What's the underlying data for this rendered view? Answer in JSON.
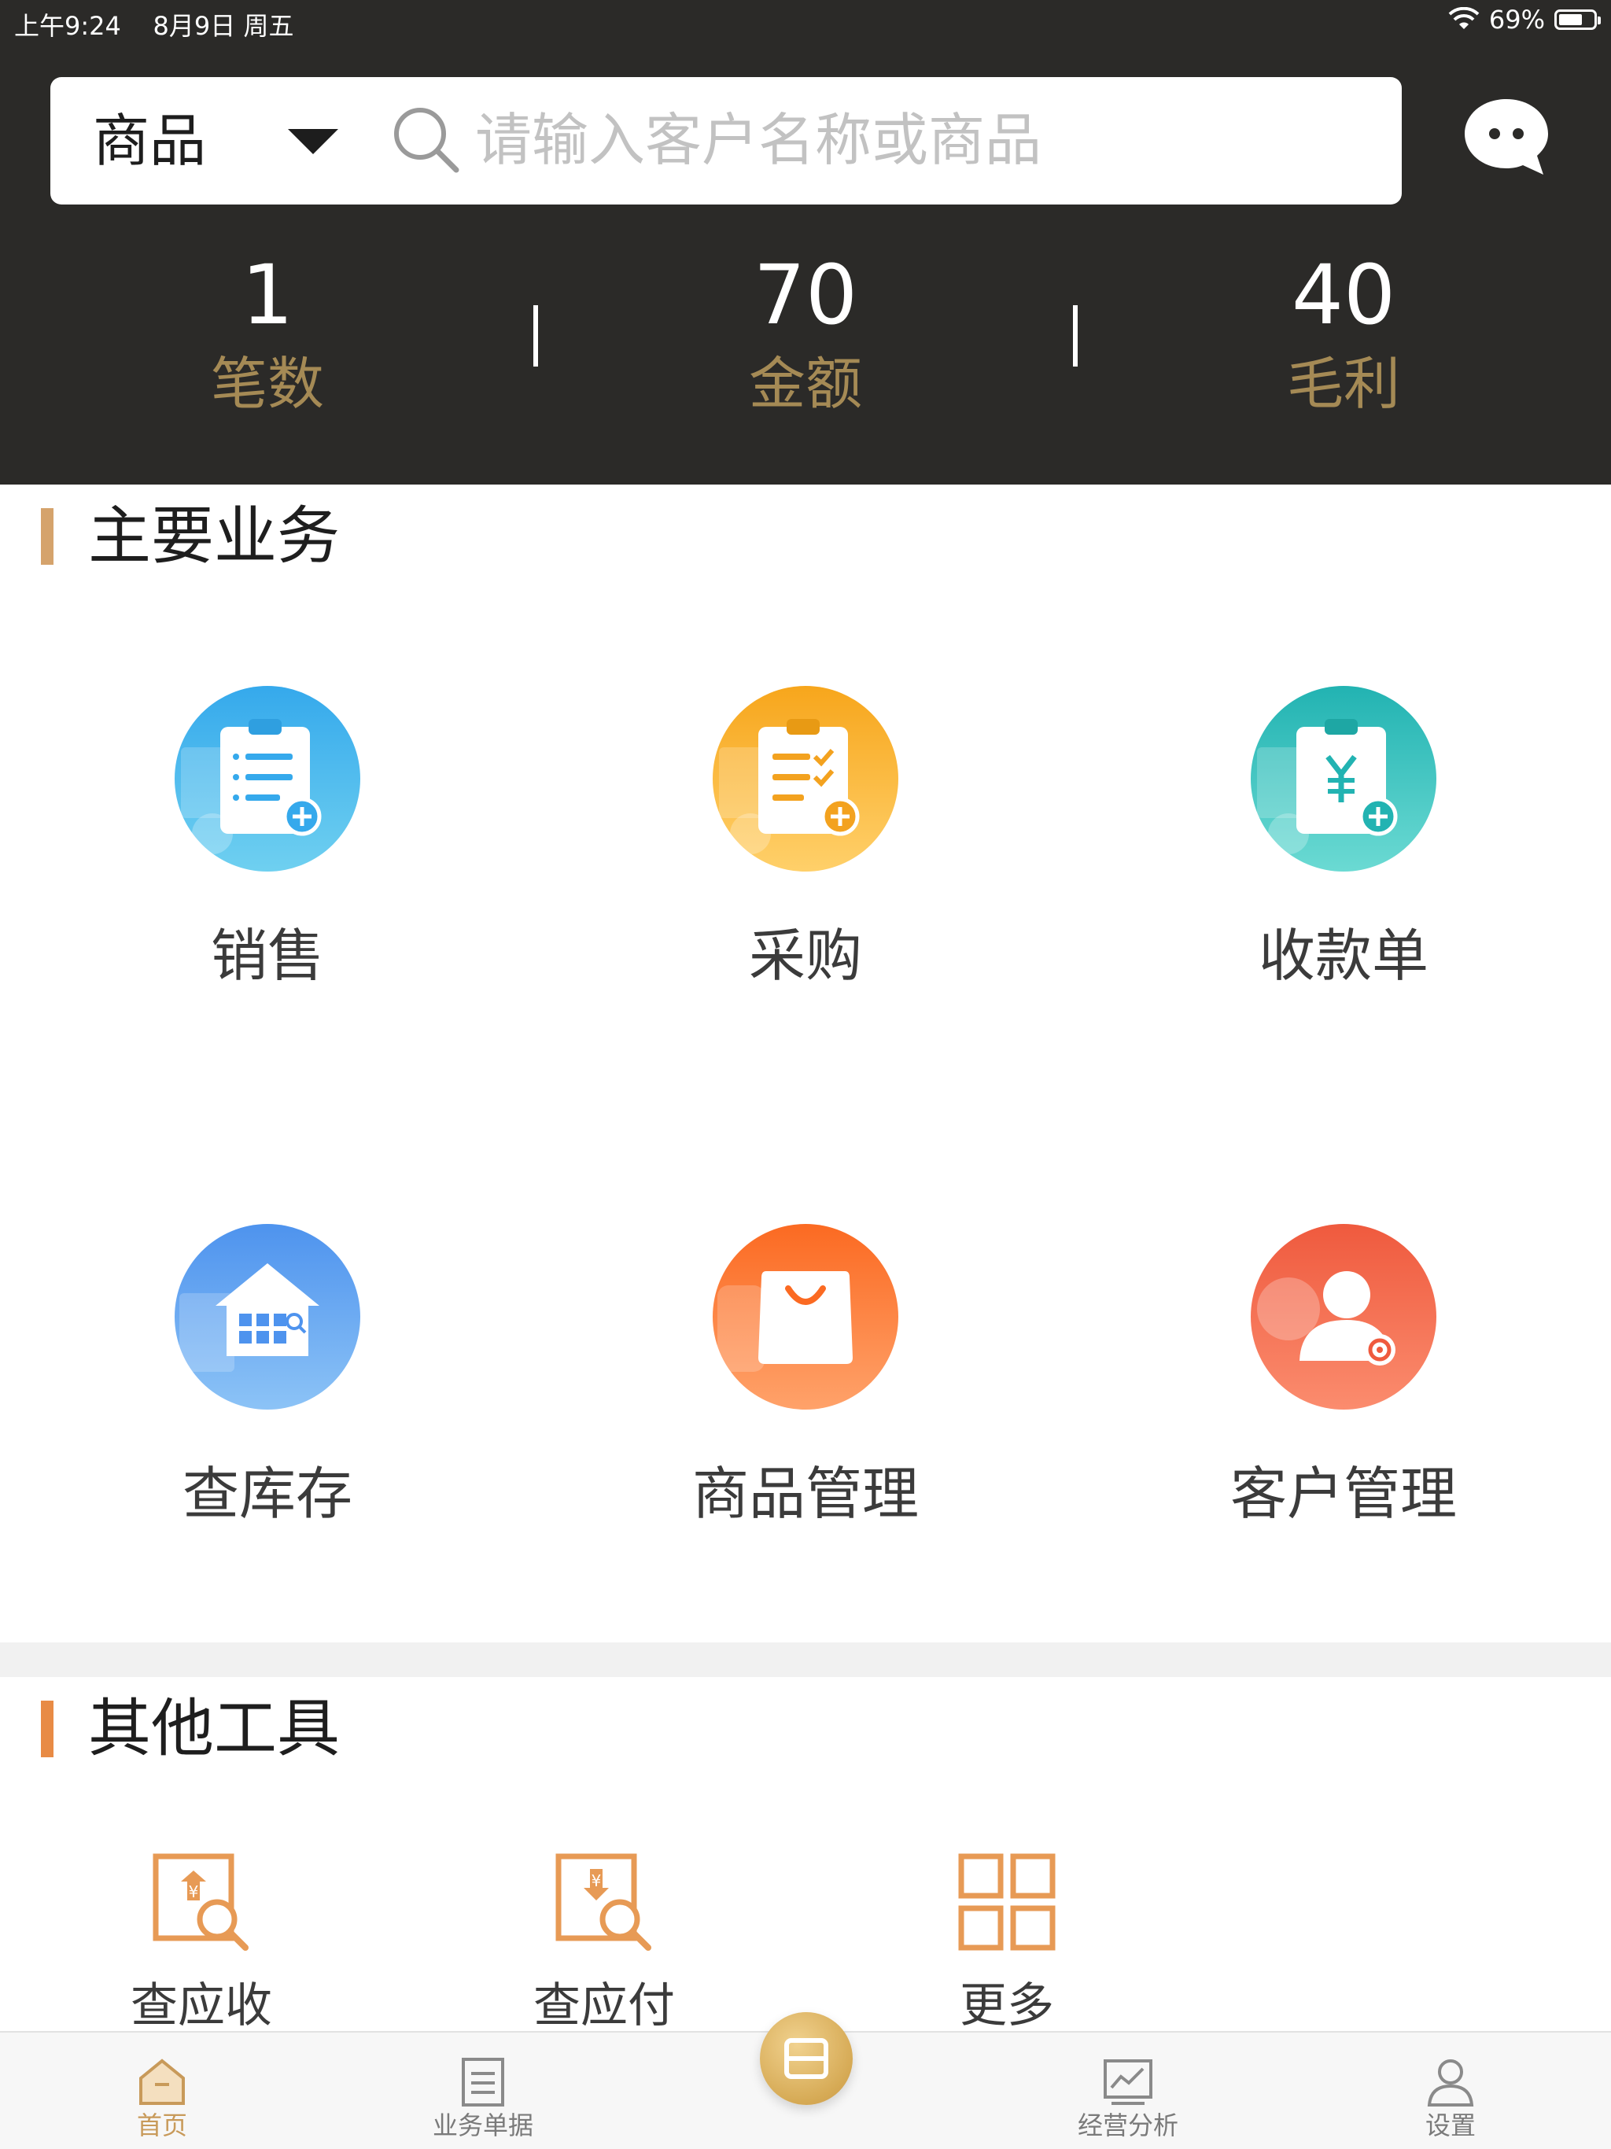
{
  "status_bar": {
    "time_date": "上午9:24    8月9日 周五",
    "battery_percent": "69%",
    "battery_level": 0.69
  },
  "search": {
    "category": "商品",
    "placeholder": "请输入客户名称或商品"
  },
  "stats": [
    {
      "value": "1",
      "label": "笔数"
    },
    {
      "value": "70",
      "label": "金额"
    },
    {
      "value": "40",
      "label": "毛利"
    }
  ],
  "main_business": {
    "title": "主要业务",
    "tiles": [
      {
        "label": "销售",
        "icon": "sales-clipboard-icon",
        "color": "#3fb6ea"
      },
      {
        "label": "采购",
        "icon": "purchase-clipboard-icon",
        "color": "#f8b12d"
      },
      {
        "label": "收款单",
        "icon": "receipt-clipboard-icon",
        "color": "#2fc3bd"
      },
      {
        "label": "查库存",
        "icon": "inventory-house-icon",
        "color": "#5d9ef0"
      },
      {
        "label": "商品管理",
        "icon": "shopping-bag-icon",
        "color": "#fb7a32"
      },
      {
        "label": "客户管理",
        "icon": "customer-person-icon",
        "color": "#f05f45"
      }
    ]
  },
  "other_tools": {
    "title": "其他工具",
    "tools": [
      {
        "label": "查应收",
        "icon": "receivable-search-icon"
      },
      {
        "label": "查应付",
        "icon": "payable-search-icon"
      },
      {
        "label": "更多",
        "icon": "grid-more-icon"
      }
    ]
  },
  "bottom_nav": {
    "items": [
      {
        "label": "首页",
        "icon": "home-icon",
        "active": true
      },
      {
        "label": "业务单据",
        "icon": "document-icon",
        "active": false
      },
      {
        "label": "经营分析",
        "icon": "chart-icon",
        "active": false
      },
      {
        "label": "设置",
        "icon": "user-settings-icon",
        "active": false
      }
    ]
  },
  "colors": {
    "header_bg": "#2b2a28",
    "accent_gold": "#c89a5a",
    "stat_label": "#a58a55",
    "tool_orange": "#e79a55"
  }
}
